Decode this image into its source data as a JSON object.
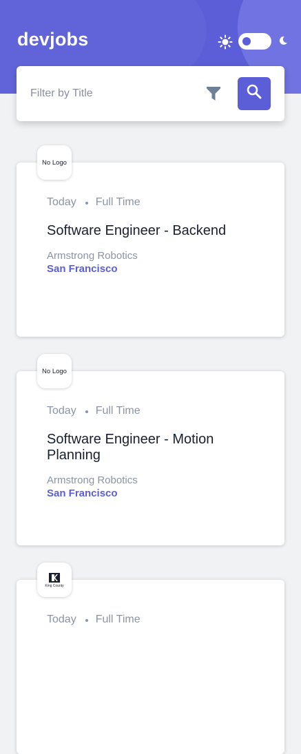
{
  "header": {
    "logo": "devjobs",
    "theme": {
      "light_icon": "sun-icon",
      "dark_icon": "moon-icon",
      "mode": "light"
    }
  },
  "search": {
    "placeholder": "Filter by Title",
    "filter_icon": "filter-icon",
    "search_icon": "search-icon"
  },
  "colors": {
    "accent": "#5b5ed6",
    "title": "#19202d",
    "muted": "#8a94a6"
  },
  "jobs": [
    {
      "logo_text": "No Logo",
      "posted": "Today",
      "type": "Full Time",
      "title": "Software Engineer - Backend",
      "company": "Armstrong Robotics",
      "location": "San Francisco"
    },
    {
      "logo_text": "No Logo",
      "posted": "Today",
      "type": "Full Time",
      "title": "Software Engineer - Motion Planning",
      "company": "Armstrong Robotics",
      "location": "San Francisco"
    },
    {
      "logo_text": "King County",
      "posted": "Today",
      "type": "Full Time"
    }
  ]
}
